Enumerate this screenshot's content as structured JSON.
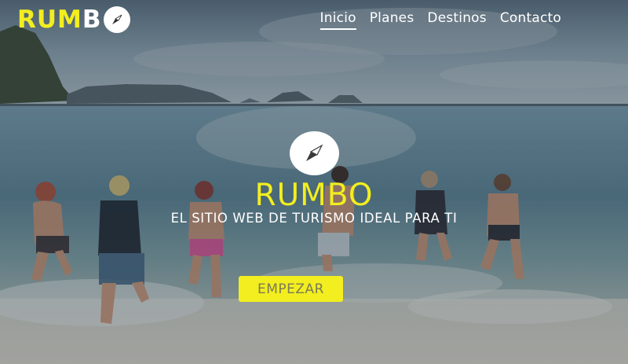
{
  "brand": {
    "logo_part_yellow": "RUM",
    "logo_part_white": "B",
    "logo_icon": "compass-icon"
  },
  "nav": {
    "items": [
      {
        "label": "Inicio",
        "active": true
      },
      {
        "label": "Planes",
        "active": false
      },
      {
        "label": "Destinos",
        "active": false
      },
      {
        "label": "Contacto",
        "active": false
      }
    ]
  },
  "hero": {
    "icon": "compass-icon",
    "title": "RUMBO",
    "subtitle": "EL SITIO WEB DE TURISMO IDEAL PARA TI",
    "cta_label": "EMPEZAR"
  },
  "colors": {
    "accent": "#f2ee1f",
    "text": "#ffffff",
    "cta_text": "#7c7a55"
  }
}
